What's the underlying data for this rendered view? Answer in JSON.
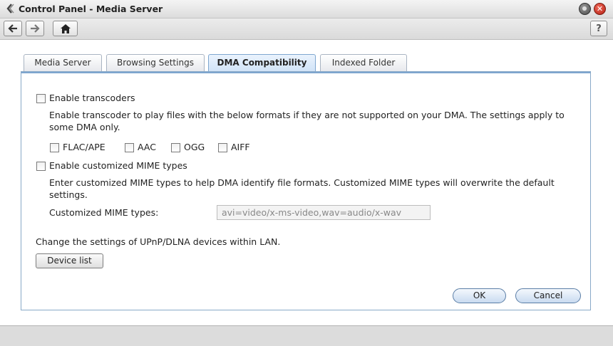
{
  "window": {
    "title": "Control Panel - Media Server",
    "close_glyph": "✕"
  },
  "toolbar": {
    "back_icon": "arrow-left-icon",
    "forward_icon": "arrow-right-icon",
    "home_icon": "home-icon",
    "help_label": "?"
  },
  "tabs": [
    {
      "label": "Media Server",
      "active": false
    },
    {
      "label": "Browsing Settings",
      "active": false
    },
    {
      "label": "DMA Compatibility",
      "active": true
    },
    {
      "label": "Indexed Folder",
      "active": false
    }
  ],
  "transcoders": {
    "checkbox_label": "Enable transcoders",
    "description": "Enable transcoder to play files with the below formats if they are not supported on your DMA. The settings apply to some DMA only.",
    "formats": [
      {
        "label": "FLAC/APE",
        "checked": false
      },
      {
        "label": "AAC",
        "checked": false
      },
      {
        "label": "OGG",
        "checked": false
      },
      {
        "label": "AIFF",
        "checked": false
      }
    ]
  },
  "mime": {
    "checkbox_label": "Enable customized MIME types",
    "description": "Enter customized MIME types to help DMA identify file formats. Customized MIME types will overwrite the default settings.",
    "field_label": "Customized MIME types:",
    "field_value": "avi=video/x-ms-video,wav=audio/x-wav"
  },
  "upnp": {
    "description": "Change the settings of UPnP/DLNA devices within LAN.",
    "device_list_label": "Device list"
  },
  "actions": {
    "ok_label": "OK",
    "cancel_label": "Cancel"
  },
  "colors": {
    "accent": "#7ea6cf",
    "close_red": "#d83b2b"
  }
}
